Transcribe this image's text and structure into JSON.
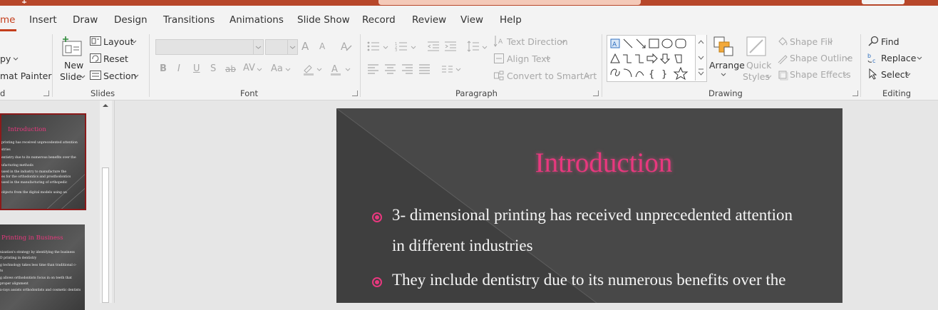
{
  "tabs": [
    {
      "label": "me",
      "active": true
    },
    {
      "label": "Insert"
    },
    {
      "label": "Draw"
    },
    {
      "label": "Design"
    },
    {
      "label": "Transitions"
    },
    {
      "label": "Animations"
    },
    {
      "label": "Slide Show"
    },
    {
      "label": "Record"
    },
    {
      "label": "Review"
    },
    {
      "label": "View"
    },
    {
      "label": "Help"
    }
  ],
  "clipboard": {
    "copy_label": "py",
    "format_painter_label": "mat Painter",
    "group_label": "d"
  },
  "slides": {
    "new_slide_label": "New",
    "new_slide_label2": "Slide",
    "layout_label": "Layout",
    "reset_label": "Reset",
    "section_label": "Section",
    "group_label": "Slides"
  },
  "font": {
    "group_label": "Font",
    "bold": "B",
    "italic": "I",
    "underline": "U",
    "shadow": "S",
    "strike": "ab",
    "spacing": "AV",
    "case": "Aa",
    "grow": "A",
    "shrink": "A"
  },
  "paragraph": {
    "group_label": "Paragraph",
    "text_direction_label": "Text Direction",
    "align_text_label": "Align Text",
    "convert_smartart_label": "Convert to SmartArt"
  },
  "drawing": {
    "group_label": "Drawing",
    "arrange_label": "Arrange",
    "quick_styles_label": "Quick",
    "quick_styles_label2": "Styles",
    "shape_fill_label": "Shape Fill",
    "shape_outline_label": "Shape Outline",
    "shape_effects_label": "Shape Effects"
  },
  "editing": {
    "group_label": "Editing",
    "find_label": "Find",
    "replace_label": "Replace",
    "select_label": "Select"
  },
  "thumbnails": {
    "slide1_title": "Introduction",
    "slide1_lines": [
      "printing has received unprecedented attention",
      "stries",
      "entistry due to its numerous benefits over the",
      "ufacturing methods",
      "used in the industry to manufacture the",
      "es for the orthodontics and prosthodontics",
      "used in the manufacturing of orthopedic",
      "objects from the digital models using an"
    ],
    "slide2_title": "Printing in Business",
    "slide2_lines": [
      "nization's strategy by identifying the business",
      "D printing in dentistry",
      "g technology takes less time than traditional c-",
      "ts",
      "g allows orthodontists focus in on teeth that",
      "proper alignment",
      "x-rays assists orthodontists and cosmetic dentists"
    ]
  },
  "slide": {
    "title": "Introduction",
    "bullets": [
      {
        "line1": "3- dimensional printing has received unprecedented attention",
        "line2": "in different industries"
      },
      {
        "line1": "They include dentistry due to its numerous benefits over the"
      }
    ]
  },
  "colors": {
    "accent": "#c43e1c",
    "titlebar": "#b7472a",
    "slide_title": "#e8387e"
  }
}
